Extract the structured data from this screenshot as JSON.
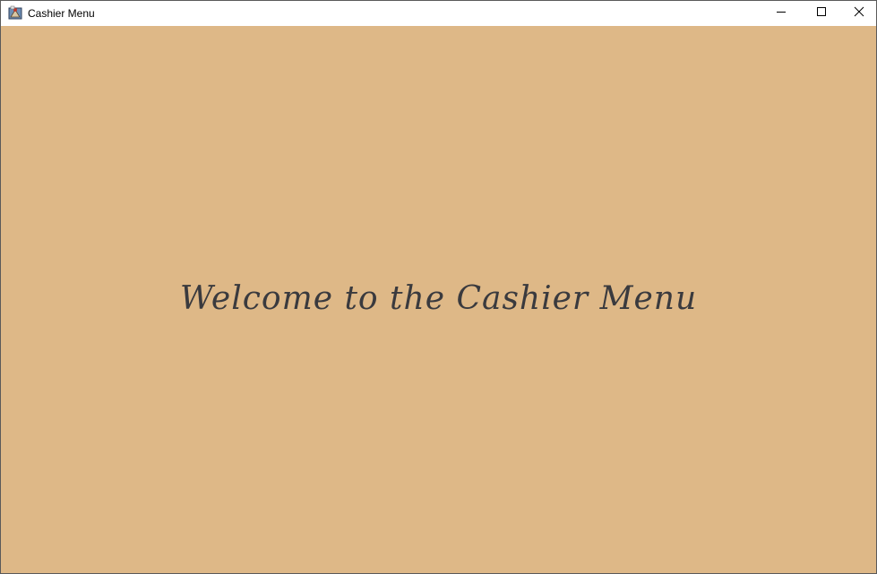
{
  "window": {
    "title": "Cashier Menu",
    "icon": "java-app-icon",
    "controls": {
      "minimize": "minimize-icon",
      "maximize": "maximize-icon",
      "close": "close-icon"
    }
  },
  "content": {
    "background_color": "#deb887",
    "welcome_text": "Welcome to the Cashier Menu",
    "text_color": "#3a3a3e"
  }
}
